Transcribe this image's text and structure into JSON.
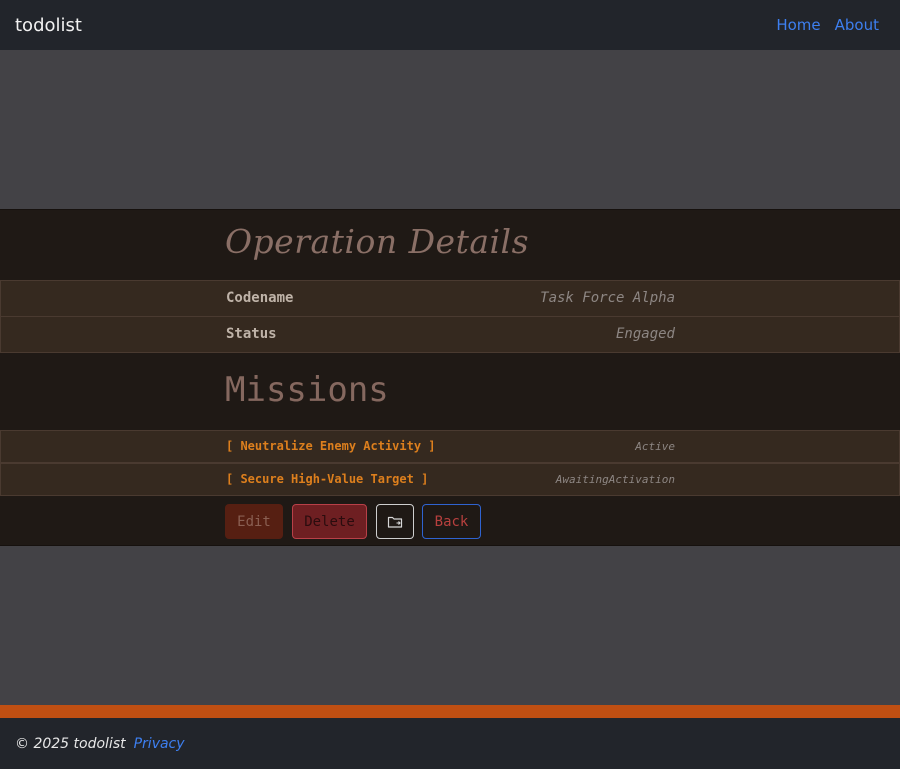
{
  "navbar": {
    "brand": "todolist",
    "links": [
      "Home",
      "About"
    ]
  },
  "details": {
    "title": "Operation Details",
    "rows": [
      {
        "label": "Codename",
        "value": "Task Force Alpha"
      },
      {
        "label": "Status",
        "value": "Engaged"
      }
    ]
  },
  "missions": {
    "title": "Missions",
    "items": [
      {
        "name": "[ Neutralize Enemy Activity ]",
        "status": "Active"
      },
      {
        "name": "[ Secure High-Value Target ]",
        "status": "AwaitingActivation"
      }
    ]
  },
  "actions": {
    "edit": "Edit",
    "delete": "Delete",
    "folder_icon": "folder-arrow-icon",
    "back": "Back"
  },
  "footer": {
    "copyright": "© 2025 todolist",
    "privacy": "Privacy"
  },
  "colors": {
    "navbar_bg": "#22252b",
    "page_bg": "#434246",
    "panel_bg": "#1f1915",
    "row_bg": "#35291f",
    "accent": "#c04f12",
    "link": "#3d7ff0",
    "mission_text": "#dd7f1d"
  }
}
